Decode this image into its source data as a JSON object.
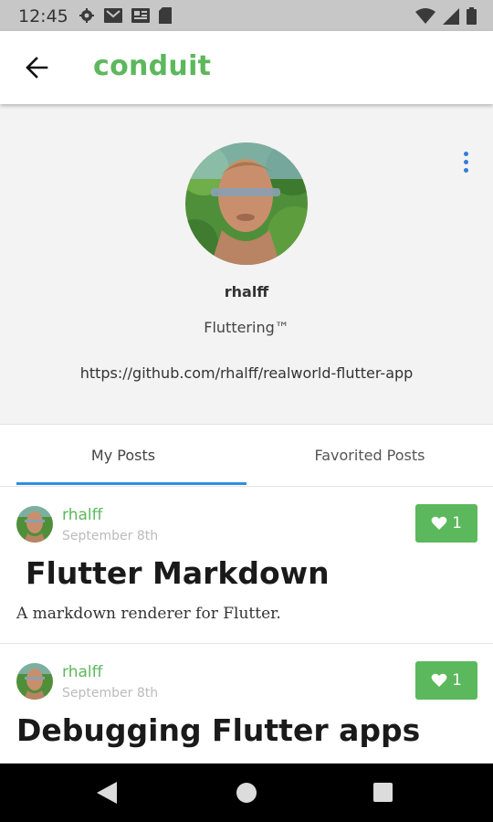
{
  "status_bar": {
    "time": "12:45",
    "left_icons": [
      "settings-icon",
      "gmail-icon",
      "news-icon",
      "sd-card-icon"
    ],
    "right_icons": [
      "wifi-icon",
      "signal-icon",
      "battery-icon"
    ]
  },
  "app_bar": {
    "back_icon": "arrow-left-icon",
    "title": "conduit"
  },
  "colors": {
    "brand": "#5cb85c",
    "tab_indicator": "#2f8fe0",
    "menu_dots": "#2f7ed8",
    "profile_bg": "#f3f3f3"
  },
  "profile": {
    "username": "rhalff",
    "bio": "Fluttering™",
    "link": "https://github.com/rhalff/realworld-flutter-app",
    "menu_icon": "more-vert-icon"
  },
  "tabs": [
    {
      "label": "My Posts",
      "selected": true
    },
    {
      "label": "Favorited Posts",
      "selected": false
    }
  ],
  "posts": [
    {
      "author": "rhalff",
      "date": "September 8th",
      "likes": "1",
      "title": "Flutter Markdown",
      "description": "A markdown renderer for Flutter."
    },
    {
      "author": "rhalff",
      "date": "September 8th",
      "likes": "1",
      "title": "Debugging Flutter apps",
      "description": ""
    }
  ],
  "nav_bar": {
    "icons": [
      "nav-back-icon",
      "nav-home-icon",
      "nav-recents-icon"
    ]
  }
}
